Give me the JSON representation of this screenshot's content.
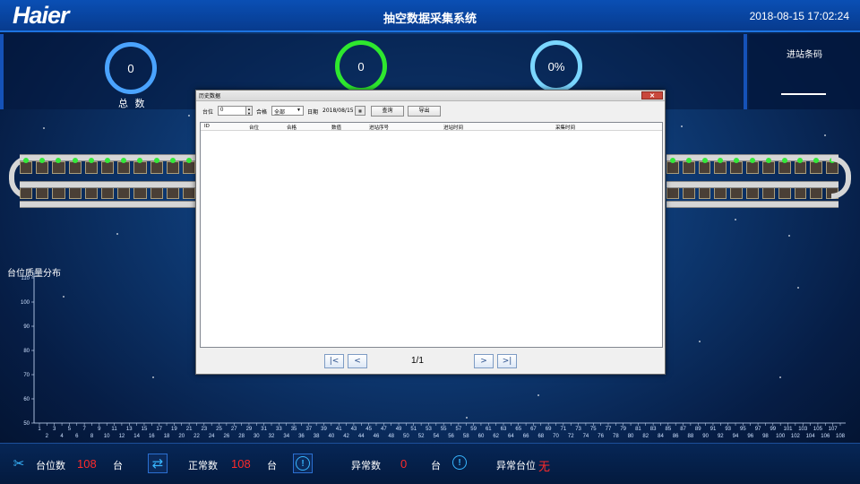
{
  "header": {
    "logo": "Haier",
    "title": "抽空数据采集系统",
    "datetime": "2018-08-15 17:02:24"
  },
  "stats": {
    "total": {
      "value": "0",
      "label": "总  数",
      "color": "#4aa3ff"
    },
    "pass": {
      "value": "0",
      "color": "#2ee82e"
    },
    "rate": {
      "value": "0%",
      "color": "#7ad6ff"
    }
  },
  "barcode_panel": {
    "title": "进站条码"
  },
  "conveyor": {
    "station_count": 108
  },
  "chart_data": {
    "type": "bar",
    "title": "台位质量分布",
    "xlabel": "",
    "ylabel": "",
    "ylim": [
      50,
      110
    ],
    "yticks": [
      50,
      60,
      70,
      80,
      90,
      100,
      110
    ],
    "xlim": [
      1,
      108
    ],
    "x_ticks_top": [
      "1",
      "3",
      "5",
      "7",
      "9",
      "11",
      "13",
      "15",
      "17",
      "19",
      "21",
      "23",
      "25",
      "27",
      "29",
      "31",
      "33",
      "35",
      "37",
      "39",
      "41",
      "43",
      "45",
      "47",
      "49",
      "51",
      "53",
      "55",
      "57",
      "59",
      "61",
      "63",
      "65",
      "67",
      "69",
      "71",
      "73",
      "75",
      "77",
      "79",
      "81",
      "83",
      "85",
      "87",
      "89",
      "91",
      "93",
      "95",
      "97",
      "99",
      "101",
      "103",
      "105",
      "107"
    ],
    "x_ticks_bottom": [
      "2",
      "4",
      "6",
      "8",
      "10",
      "12",
      "14",
      "16",
      "18",
      "20",
      "22",
      "24",
      "26",
      "28",
      "30",
      "32",
      "34",
      "36",
      "38",
      "40",
      "42",
      "44",
      "46",
      "48",
      "50",
      "52",
      "54",
      "56",
      "58",
      "60",
      "62",
      "64",
      "66",
      "68",
      "70",
      "72",
      "74",
      "76",
      "78",
      "80",
      "82",
      "84",
      "86",
      "88",
      "90",
      "92",
      "94",
      "96",
      "98",
      "100",
      "102",
      "104",
      "106",
      "108"
    ],
    "values": []
  },
  "footer": {
    "stations_label": "台位数",
    "stations_value": "108",
    "stations_unit": "台",
    "normal_label": "正常数",
    "normal_value": "108",
    "normal_unit": "台",
    "abnormal_label": "异常数",
    "abnormal_value": "0",
    "abnormal_unit": "台",
    "abnormal_station_label": "异常台位",
    "abnormal_station_value": "无",
    "alert_glyph": "!"
  },
  "dialog": {
    "title": "历史数据",
    "close": "✕",
    "station_label": "台位",
    "station_value": "0",
    "pass_label": "合格",
    "pass_value": "全部",
    "date_label": "日期",
    "date_value": "2018/08/15",
    "query_button": "查询",
    "export_button": "导出",
    "columns": [
      "ID",
      "台位",
      "合格",
      "数值",
      "进站序号",
      "进站时间",
      "采集时间"
    ],
    "pager": {
      "first": "|<",
      "prev": "<",
      "next": ">",
      "last": ">|",
      "page_text": "1/1"
    }
  }
}
